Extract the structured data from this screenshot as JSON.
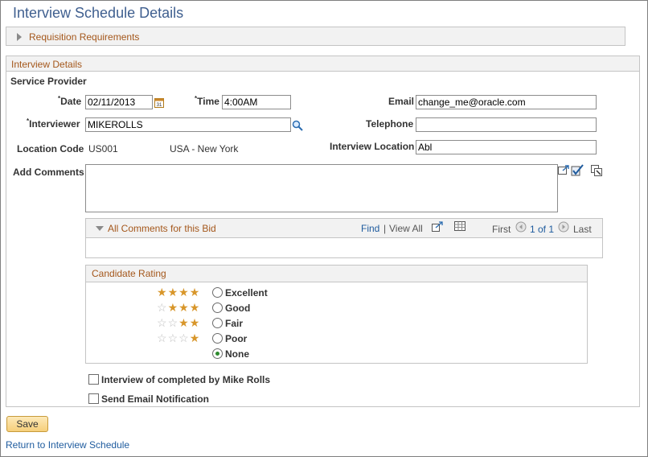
{
  "page": {
    "title": "Interview Schedule Details"
  },
  "requisition": {
    "label": "Requisition Requirements"
  },
  "interview_details": {
    "header": "Interview Details",
    "service_provider_label": "Service Provider",
    "date_label": "Date",
    "date_value": "02/11/2013",
    "time_label": "Time",
    "time_value": "4:00AM",
    "email_label": "Email",
    "email_value": "change_me@oracle.com",
    "interviewer_label": "Interviewer",
    "interviewer_value": "MIKEROLLS",
    "telephone_label": "Telephone",
    "telephone_value": "",
    "location_code_label": "Location Code",
    "location_code_value": "US001",
    "location_desc": "USA - New York",
    "interview_location_label": "Interview Location",
    "interview_location_value": "Abl",
    "add_comments_label": "Add Comments",
    "add_comments_value": ""
  },
  "comments_grid": {
    "title": "All Comments for this Bid",
    "find": "Find",
    "sep": "|",
    "view_all": "View All",
    "first": "First",
    "page_info": "1 of 1",
    "last": "Last"
  },
  "candidate_rating": {
    "header": "Candidate Rating",
    "options": [
      {
        "label": "Excellent",
        "stars": 4,
        "selected": false
      },
      {
        "label": "Good",
        "stars": 3,
        "selected": false
      },
      {
        "label": "Fair",
        "stars": 2,
        "selected": false
      },
      {
        "label": "Poor",
        "stars": 1,
        "selected": false
      },
      {
        "label": "None",
        "stars": 0,
        "selected": true
      }
    ]
  },
  "checkboxes": {
    "interview_completed": "Interview of completed by Mike Rolls",
    "send_email": "Send Email Notification"
  },
  "actions": {
    "save": "Save",
    "return_link": "Return to Interview Schedule"
  },
  "colors": {
    "title": "#3f5f8f",
    "section_label": "#a4571b",
    "link": "#1e5b9e",
    "star_on": "#d8962a",
    "star_off": "#bfbfbf"
  }
}
